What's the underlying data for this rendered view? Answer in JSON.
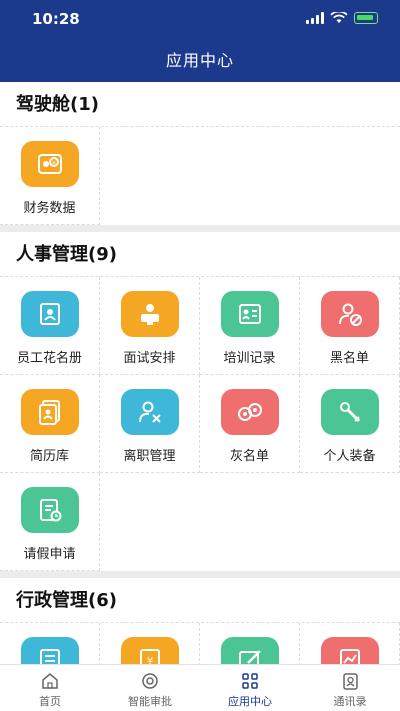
{
  "status": {
    "time": "10:28"
  },
  "header": {
    "title": "应用中心"
  },
  "sections": [
    {
      "title": "驾驶舱(1)",
      "items": [
        {
          "label": "财务数据",
          "color": "#f5a623",
          "icon": "finance-data-icon"
        }
      ]
    },
    {
      "title": "人事管理(9)",
      "items": [
        {
          "label": "员工花名册",
          "color": "#3fb7d9",
          "icon": "roster-icon"
        },
        {
          "label": "面试安排",
          "color": "#f5a623",
          "icon": "interview-icon"
        },
        {
          "label": "培训记录",
          "color": "#4cc594",
          "icon": "training-icon"
        },
        {
          "label": "黑名单",
          "color": "#ef6e6e",
          "icon": "blacklist-icon"
        },
        {
          "label": "简历库",
          "color": "#f5a623",
          "icon": "resume-icon"
        },
        {
          "label": "离职管理",
          "color": "#3fb7d9",
          "icon": "resign-icon"
        },
        {
          "label": "灰名单",
          "color": "#ef6e6e",
          "icon": "graylist-icon"
        },
        {
          "label": "个人装备",
          "color": "#4cc594",
          "icon": "equipment-icon"
        },
        {
          "label": "请假申请",
          "color": "#4cc594",
          "icon": "leave-icon"
        }
      ]
    },
    {
      "title": "行政管理(6)",
      "items": [
        {
          "label": "",
          "color": "#3fb7d9",
          "icon": "admin-document-icon"
        },
        {
          "label": "",
          "color": "#f5a623",
          "icon": "expense-icon"
        },
        {
          "label": "",
          "color": "#4cc594",
          "icon": "edit-icon"
        },
        {
          "label": "",
          "color": "#ef6e6e",
          "icon": "report-icon"
        }
      ]
    }
  ],
  "tabs": [
    {
      "label": "首页",
      "icon": "home-icon",
      "active": false
    },
    {
      "label": "智能审批",
      "icon": "approval-icon",
      "active": false
    },
    {
      "label": "应用中心",
      "icon": "apps-icon",
      "active": true
    },
    {
      "label": "通讯录",
      "icon": "contacts-icon",
      "active": false
    }
  ]
}
